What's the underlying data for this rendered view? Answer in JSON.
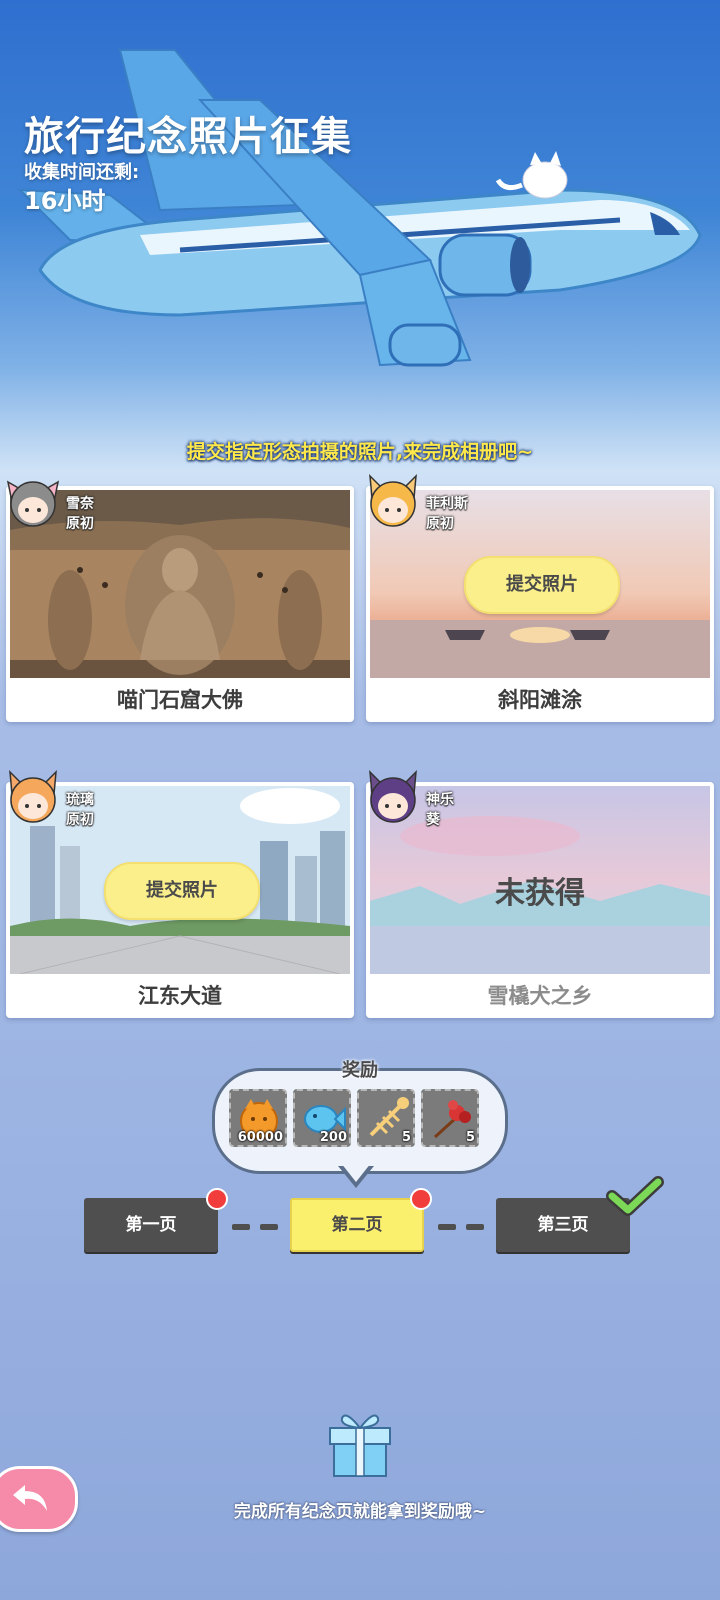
{
  "header": {
    "title": "旅行纪念照片征集",
    "timer_label": "收集时间还剩:",
    "timer_value": "16小时",
    "subtitle": "提交指定形态拍摄的照片,来完成相册吧~"
  },
  "cards": [
    {
      "location": "喵门石窟大佛",
      "character_line1": "雪奈",
      "character_line2": "原初",
      "status": "submitted"
    },
    {
      "location": "斜阳滩涂",
      "character_line1": "菲利斯",
      "character_line2": "原初",
      "status": "submit",
      "button_label": "提交照片"
    },
    {
      "location": "江东大道",
      "character_line1": "琉璃",
      "character_line2": "原初",
      "status": "submit",
      "button_label": "提交照片"
    },
    {
      "location": "雪橇犬之乡",
      "character_line1": "神乐",
      "character_line2": "葵",
      "status": "locked",
      "locked_label": "未获得"
    }
  ],
  "rewards": {
    "title": "奖励",
    "items": [
      {
        "icon": "cat-coin-icon",
        "count": "60000"
      },
      {
        "icon": "blue-fish-icon",
        "count": "200"
      },
      {
        "icon": "fish-bone-icon",
        "count": "5"
      },
      {
        "icon": "red-flower-icon",
        "count": "5"
      }
    ]
  },
  "pages": [
    {
      "label": "第一页",
      "badge": true,
      "active": false,
      "completed": false
    },
    {
      "label": "第二页",
      "badge": true,
      "active": true,
      "completed": false
    },
    {
      "label": "第三页",
      "badge": false,
      "active": false,
      "completed": true
    }
  ],
  "footer": {
    "text": "完成所有纪念页就能拿到奖励哦~"
  },
  "colors": {
    "accent_yellow": "#fbef8c",
    "badge_red": "#f23d3d",
    "check_green": "#7cd957",
    "page_dark": "#4f4f4f",
    "subtitle_yellow": "#ffe84a"
  }
}
